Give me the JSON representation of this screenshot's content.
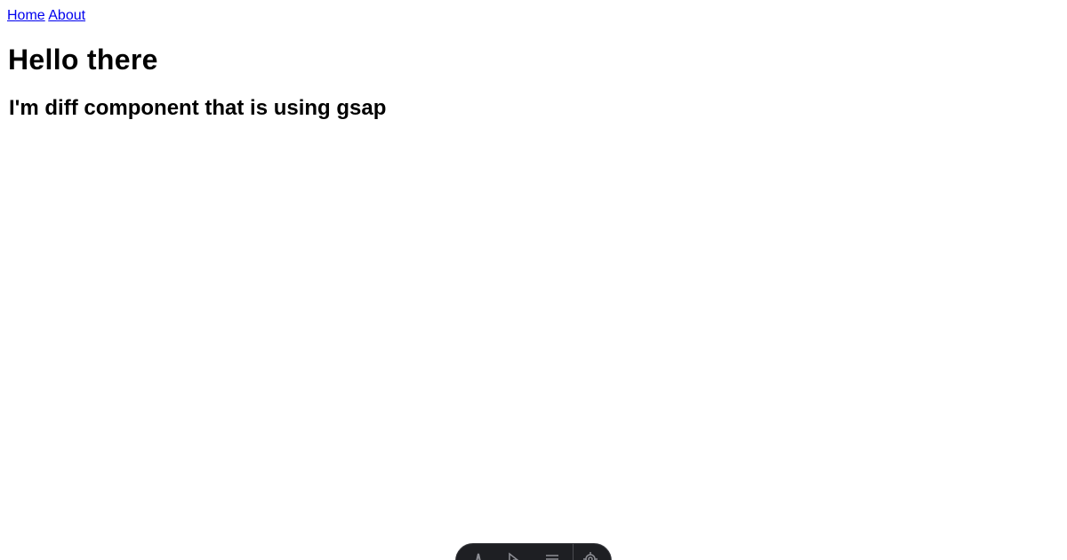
{
  "nav": {
    "home_label": "Home",
    "about_label": "About"
  },
  "main": {
    "title": "Hello there",
    "subtitle": "I'm diff component that is using gsap"
  },
  "devtools_toolbar": {
    "icons": [
      "astro-logo-icon",
      "cursor-icon",
      "menu-icon",
      "settings-icon"
    ]
  },
  "colors": {
    "link": "#0000ee",
    "toolbar_bg": "#1e1f23"
  }
}
